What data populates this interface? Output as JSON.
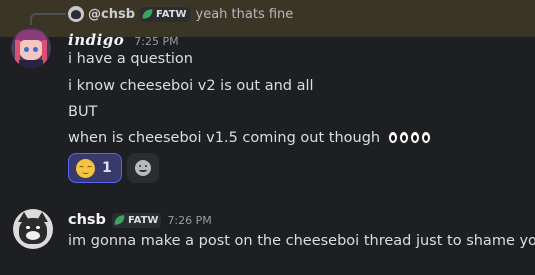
{
  "reply": {
    "author": "@chsb",
    "tag": "FATW",
    "text": "yeah thats fine"
  },
  "message1": {
    "author": "indigo",
    "timestamp": "7:25 PM",
    "lines": [
      "i have a question",
      "i know cheeseboi v2 is out and all",
      "BUT",
      "when is cheeseboi v1.5 coming out though"
    ],
    "trailing_emoji": [
      "eyes",
      "eyes",
      "eyes",
      "eyes"
    ],
    "reactions": [
      {
        "emoji": "relieved-face",
        "count": "1",
        "active": true
      }
    ],
    "add_reaction_icon": "add-reaction-smiley"
  },
  "message2": {
    "author": "chsb",
    "tag": "FATW",
    "timestamp": "7:26 PM",
    "text": "im gonna make a post on the cheeseboi thread just to shame you"
  },
  "colors": {
    "background": "#1e1f22",
    "highlight": "#3b3526",
    "reaction_active_bg": "#373a6b",
    "reaction_active_border": "#5865f2",
    "tag_leaf": "#3ba55c"
  }
}
